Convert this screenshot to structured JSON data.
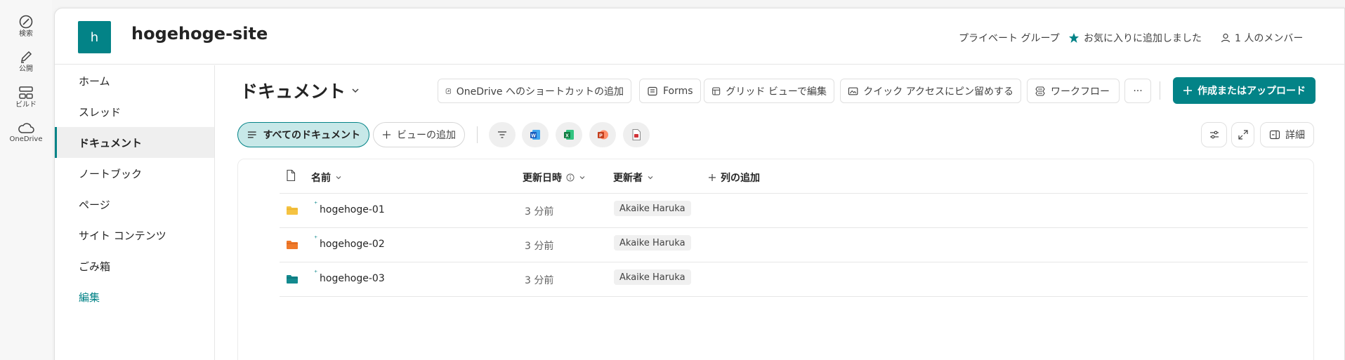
{
  "rail": {
    "items": [
      {
        "label": "検索",
        "icon": "search-icon"
      },
      {
        "label": "公開",
        "icon": "pen-icon"
      },
      {
        "label": "ビルド",
        "icon": "build-icon"
      },
      {
        "label": "OneDrive",
        "icon": "cloud-icon"
      }
    ]
  },
  "site": {
    "logo_letter": "h",
    "title": "hogehoge-site",
    "privacy": "プライベート グループ",
    "favorite": "お気に入りに追加しました",
    "members": "1 人のメンバー"
  },
  "nav": {
    "items": [
      "ホーム",
      "スレッド",
      "ドキュメント",
      "ノートブック",
      "ページ",
      "サイト コンテンツ",
      "ごみ箱"
    ],
    "edit": "編集",
    "active_index": 2
  },
  "library": {
    "title": "ドキュメント"
  },
  "commands": {
    "onedrive_shortcut": "OneDrive へのショートカットの追加",
    "forms": "Forms",
    "grid_edit": "グリッド ビューで編集",
    "pin_quick_access": "クイック アクセスにピン留めする",
    "workflow": "ワークフロー",
    "more": "···",
    "create_upload": "作成またはアップロード"
  },
  "views": {
    "all_documents": "すべてのドキュメント",
    "add_view": "ビューの追加",
    "details": "詳細"
  },
  "table": {
    "columns": {
      "name": "名前",
      "modified": "更新日時",
      "modified_by": "更新者",
      "add_column": "列の追加"
    },
    "rows": [
      {
        "name": "hogehoge-01",
        "modified": "3 分前",
        "modified_by": "Akaike Haruka",
        "folder_color": "#f5c342"
      },
      {
        "name": "hogehoge-02",
        "modified": "3 分前",
        "modified_by": "Akaike Haruka",
        "folder_color": "#f07a2a"
      },
      {
        "name": "hogehoge-03",
        "modified": "3 分前",
        "modified_by": "Akaike Haruka",
        "folder_color": "#138a8f"
      }
    ]
  },
  "colors": {
    "accent": "#038387",
    "selected_view_bg": "#c7e8e8"
  }
}
